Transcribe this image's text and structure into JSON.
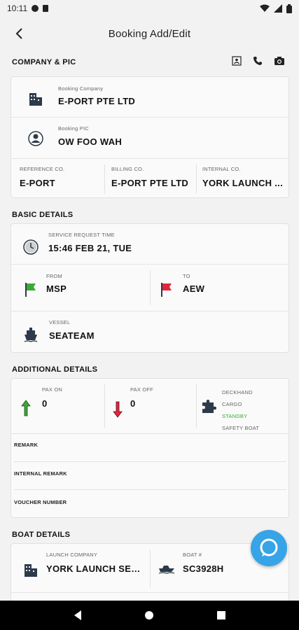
{
  "status": {
    "time": "10:11"
  },
  "header": {
    "title": "Booking Add/Edit"
  },
  "company_pic": {
    "heading": "COMPANY & PIC",
    "booking_company_label": "Booking Company",
    "booking_company": "E-PORT PTE LTD",
    "booking_pic_label": "Booking PIC",
    "booking_pic": "OW FOO WAH",
    "reference_label": "REFERENCE CO.",
    "reference": "E-PORT",
    "billing_label": "BILLING CO.",
    "billing": "E-PORT PTE LTD",
    "internal_label": "INTERNAL CO.",
    "internal": "YORK LAUNCH ..."
  },
  "basic": {
    "heading": "BASIC DETAILS",
    "service_time_label": "SERVICE REQUEST TIME",
    "service_time": "15:46 FEB 21, TUE",
    "from_label": "FROM",
    "from": "MSP",
    "to_label": "TO",
    "to": "AEW",
    "vessel_label": "VESSEL",
    "vessel": "SEATEAM"
  },
  "additional": {
    "heading": "ADDITIONAL DETAILS",
    "pax_on_label": "PAX ON",
    "pax_on": "0",
    "pax_off_label": "PAX OFF",
    "pax_off": "0",
    "services": [
      "DECKHAND",
      "CARGO",
      "STANDBY",
      "SAFETY BOAT"
    ],
    "remark_label": "REMARK",
    "internal_remark_label": "INTERNAL REMARK",
    "voucher_label": "VOUCHER NUMBER"
  },
  "boat": {
    "heading": "BOAT DETAILS",
    "launch_company_label": "LAUNCH COMPANY",
    "launch_company": "YORK LAUNCH SER...",
    "boat_no_label": "BOAT #",
    "boat_no": "SC3928H"
  },
  "colors": {
    "accent": "#36a4e6",
    "green_flag": "#3aaa35",
    "red_flag": "#e0263f",
    "standby": "#3aaa35"
  }
}
